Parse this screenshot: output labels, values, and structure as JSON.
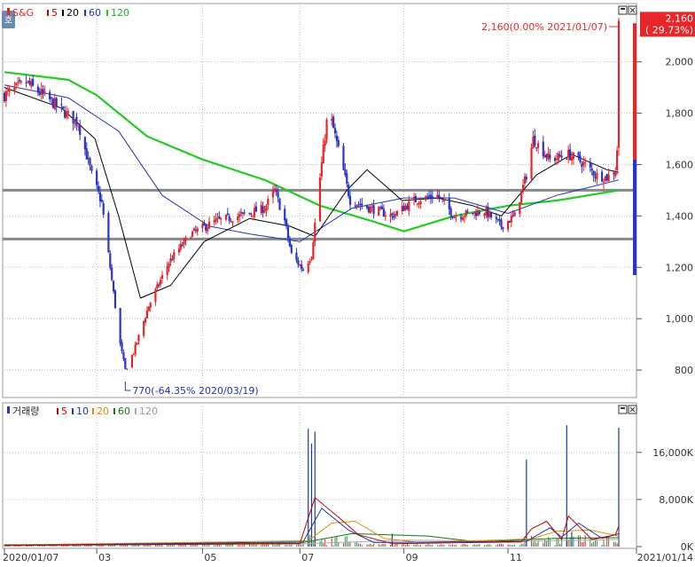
{
  "price_legend": {
    "symbol": "S&G",
    "ma_labels": [
      "5",
      "20",
      "60",
      "120"
    ]
  },
  "side_button": "호",
  "volume_legend": {
    "title": "거래량",
    "ma_labels": [
      "5",
      "10",
      "20",
      "60",
      "120"
    ]
  },
  "colors": {
    "up": "#e8262a",
    "down": "#2a35c8",
    "ma5": "#c00000",
    "ma20": "#000000",
    "ma60": "#2233bb",
    "ma120": "#22cc22",
    "hline": "#888888",
    "grid": "#b8b8b8",
    "axis_text": "#333333"
  },
  "chart_data": [
    {
      "type": "candlestick",
      "price_axis": {
        "ylim": [
          700,
          2220
        ],
        "ticks": [
          "2,000",
          "1,800",
          "1,600",
          "1,400",
          "1,200",
          "1,000",
          "800"
        ],
        "tick_values": [
          2000,
          1800,
          1600,
          1400,
          1200,
          1000,
          800
        ]
      },
      "x_axis": {
        "range": [
          "2020-01-07",
          "2021-01-14"
        ],
        "tick_labels": [
          "2020/01/07",
          "03",
          "05",
          "07",
          "09",
          "11",
          "2021/01/14"
        ],
        "tick_dates": [
          "2020-01-07",
          "2020-03-02",
          "2020-05-04",
          "2020-07-01",
          "2020-09-01",
          "2020-11-02",
          "2021-01-14"
        ]
      },
      "price_path": [
        [
          "2020-01-07",
          1870
        ],
        [
          "2020-01-20",
          1920
        ],
        [
          "2020-02-05",
          1840
        ],
        [
          "2020-02-20",
          1760
        ],
        [
          "2020-02-28",
          1560
        ],
        [
          "2020-03-05",
          1450
        ],
        [
          "2020-03-10",
          1200
        ],
        [
          "2020-03-16",
          900
        ],
        [
          "2020-03-19",
          800
        ],
        [
          "2020-03-24",
          870
        ],
        [
          "2020-04-02",
          1050
        ],
        [
          "2020-04-14",
          1220
        ],
        [
          "2020-04-27",
          1330
        ],
        [
          "2020-05-12",
          1380
        ],
        [
          "2020-05-26",
          1400
        ],
        [
          "2020-06-10",
          1430
        ],
        [
          "2020-06-16",
          1500
        ],
        [
          "2020-06-22",
          1380
        ],
        [
          "2020-06-26",
          1250
        ],
        [
          "2020-07-03",
          1190
        ],
        [
          "2020-07-08",
          1250
        ],
        [
          "2020-07-13",
          1550
        ],
        [
          "2020-07-18",
          1820
        ],
        [
          "2020-07-25",
          1630
        ],
        [
          "2020-07-31",
          1460
        ],
        [
          "2020-08-12",
          1430
        ],
        [
          "2020-08-25",
          1400
        ],
        [
          "2020-09-07",
          1460
        ],
        [
          "2020-09-21",
          1480
        ],
        [
          "2020-10-01",
          1400
        ],
        [
          "2020-10-19",
          1420
        ],
        [
          "2020-10-29",
          1360
        ],
        [
          "2020-11-06",
          1400
        ],
        [
          "2020-11-13",
          1560
        ],
        [
          "2020-11-17",
          1700
        ],
        [
          "2020-11-27",
          1620
        ],
        [
          "2020-12-08",
          1640
        ],
        [
          "2020-12-18",
          1600
        ],
        [
          "2020-12-24",
          1560
        ],
        [
          "2020-12-31",
          1550
        ],
        [
          "2021-01-05",
          1580
        ],
        [
          "2021-01-06",
          1660
        ],
        [
          "2021-01-07",
          2160
        ]
      ],
      "annotations": {
        "high_label": "2,160(0.00% 2021/01/07)",
        "low_label": "770(-64.35% 2020/03/19)",
        "last_price": "2,160",
        "last_change": "( 29.73%)"
      },
      "horizontal_lines": [
        1500,
        1310
      ],
      "moving_averages": {
        "ma20": [
          [
            "2020-01-07",
            1900
          ],
          [
            "2020-02-10",
            1820
          ],
          [
            "2020-03-01",
            1700
          ],
          [
            "2020-03-15",
            1400
          ],
          [
            "2020-03-28",
            1080
          ],
          [
            "2020-04-15",
            1130
          ],
          [
            "2020-05-05",
            1300
          ],
          [
            "2020-06-01",
            1390
          ],
          [
            "2020-06-25",
            1360
          ],
          [
            "2020-07-10",
            1320
          ],
          [
            "2020-07-29",
            1500
          ],
          [
            "2020-08-10",
            1580
          ],
          [
            "2020-08-31",
            1460
          ],
          [
            "2020-09-21",
            1470
          ],
          [
            "2020-10-12",
            1440
          ],
          [
            "2020-10-29",
            1400
          ],
          [
            "2020-11-19",
            1560
          ],
          [
            "2020-12-10",
            1640
          ],
          [
            "2020-12-31",
            1580
          ],
          [
            "2021-01-07",
            1570
          ]
        ],
        "ma60": [
          [
            "2020-01-07",
            1910
          ],
          [
            "2020-02-14",
            1860
          ],
          [
            "2020-03-15",
            1730
          ],
          [
            "2020-04-10",
            1480
          ],
          [
            "2020-05-08",
            1360
          ],
          [
            "2020-06-01",
            1330
          ],
          [
            "2020-07-01",
            1300
          ],
          [
            "2020-08-01",
            1430
          ],
          [
            "2020-09-01",
            1470
          ],
          [
            "2020-10-01",
            1470
          ],
          [
            "2020-11-02",
            1410
          ],
          [
            "2020-12-01",
            1480
          ],
          [
            "2021-01-07",
            1540
          ]
        ],
        "ma120": [
          [
            "2020-01-07",
            1960
          ],
          [
            "2020-02-14",
            1930
          ],
          [
            "2020-03-02",
            1870
          ],
          [
            "2020-04-01",
            1710
          ],
          [
            "2020-05-04",
            1620
          ],
          [
            "2020-06-10",
            1540
          ],
          [
            "2020-07-13",
            1440
          ],
          [
            "2020-08-13",
            1380
          ],
          [
            "2020-09-01",
            1340
          ],
          [
            "2020-10-01",
            1400
          ],
          [
            "2020-11-02",
            1440
          ],
          [
            "2020-12-01",
            1460
          ],
          [
            "2021-01-07",
            1500
          ]
        ]
      }
    },
    {
      "type": "bar",
      "title": "거래량",
      "y_axis": {
        "ylim": [
          0,
          22000
        ],
        "unit": "K",
        "ticks": [
          "16,000K",
          "8,000K",
          "0K"
        ],
        "tick_values": [
          16000,
          8000,
          0
        ]
      },
      "spikes": [
        [
          "2020-07-06",
          20000
        ],
        [
          "2020-07-08",
          17500
        ],
        [
          "2020-07-10",
          19500
        ],
        [
          "2020-08-25",
          2200
        ],
        [
          "2020-11-13",
          14800
        ],
        [
          "2020-12-07",
          20600
        ],
        [
          "2020-12-10",
          2500
        ],
        [
          "2021-01-07",
          20200
        ]
      ],
      "baseline_range": [
        200,
        1800
      ],
      "moving_averages": {
        "ma5": [
          [
            "2020-01-07",
            200
          ],
          [
            "2020-07-01",
            500
          ],
          [
            "2020-07-10",
            8300
          ],
          [
            "2020-07-24",
            5000
          ],
          [
            "2020-08-05",
            2000
          ],
          [
            "2020-08-25",
            500
          ],
          [
            "2020-11-10",
            800
          ],
          [
            "2020-11-16",
            3000
          ],
          [
            "2020-11-25",
            4300
          ],
          [
            "2020-12-04",
            1200
          ],
          [
            "2020-12-08",
            5200
          ],
          [
            "2020-12-22",
            1200
          ],
          [
            "2021-01-05",
            2000
          ],
          [
            "2021-01-07",
            3500
          ]
        ],
        "ma10": [
          [
            "2020-01-07",
            200
          ],
          [
            "2020-07-03",
            800
          ],
          [
            "2020-07-14",
            6500
          ],
          [
            "2020-07-30",
            2800
          ],
          [
            "2020-08-14",
            700
          ],
          [
            "2020-11-13",
            900
          ],
          [
            "2020-11-27",
            3200
          ],
          [
            "2020-12-04",
            1600
          ],
          [
            "2020-12-14",
            4000
          ],
          [
            "2020-12-28",
            1400
          ],
          [
            "2021-01-07",
            2200
          ]
        ],
        "ma20": [
          [
            "2020-01-07",
            250
          ],
          [
            "2020-07-06",
            1000
          ],
          [
            "2020-07-20",
            4000
          ],
          [
            "2020-08-03",
            4300
          ],
          [
            "2020-08-20",
            1400
          ],
          [
            "2020-09-10",
            700
          ],
          [
            "2020-11-16",
            1300
          ],
          [
            "2020-12-01",
            2600
          ],
          [
            "2020-12-21",
            2800
          ],
          [
            "2021-01-07",
            1800
          ]
        ],
        "ma60": [
          [
            "2020-01-07",
            300
          ],
          [
            "2020-07-01",
            600
          ],
          [
            "2020-08-01",
            2200
          ],
          [
            "2020-09-15",
            1800
          ],
          [
            "2020-10-15",
            800
          ],
          [
            "2020-11-30",
            1400
          ],
          [
            "2020-12-31",
            1500
          ],
          [
            "2021-01-07",
            1500
          ]
        ],
        "ma120": [
          [
            "2020-01-07",
            350
          ],
          [
            "2020-07-01",
            450
          ],
          [
            "2020-09-01",
            1100
          ],
          [
            "2020-11-01",
            900
          ],
          [
            "2021-01-07",
            1200
          ]
        ]
      }
    }
  ]
}
